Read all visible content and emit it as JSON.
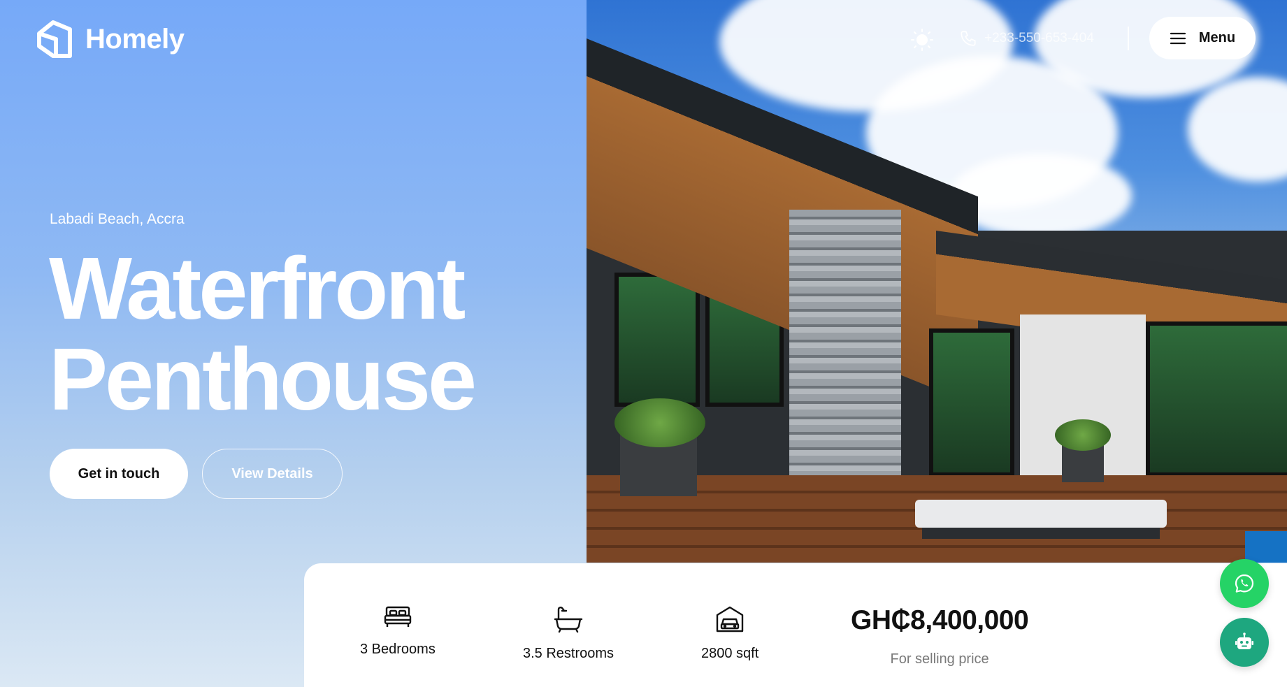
{
  "header": {
    "brand_name": "Homely",
    "phone": "+233-550-653-404",
    "menu_label": "Menu"
  },
  "hero": {
    "location": "Labadi Beach, Accra",
    "title_line1": "Waterfront",
    "title_line2": "Penthouse",
    "primary_button": "Get in touch",
    "secondary_button": "View Details"
  },
  "features": {
    "bedrooms": "3 Bedrooms",
    "restrooms": "3.5 Restrooms",
    "area": "2800 sqft"
  },
  "price": {
    "value": "GH₵8,400,000",
    "label": "For selling price"
  },
  "colors": {
    "hero_gradient_top": "#76a9f8",
    "whatsapp": "#25d366",
    "bot": "#1ea77f"
  }
}
